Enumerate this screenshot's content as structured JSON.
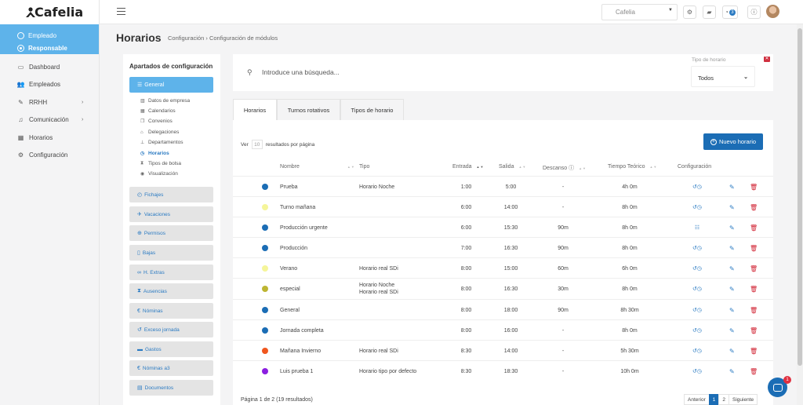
{
  "app": {
    "logo": "Cafelia"
  },
  "roles": [
    {
      "label": "Empleado"
    },
    {
      "label": "Responsable"
    }
  ],
  "sidebar": [
    {
      "label": "Dashboard",
      "icon": "monitor-icon"
    },
    {
      "label": "Empleados",
      "icon": "users-icon"
    },
    {
      "label": "RRHH",
      "icon": "edit-icon"
    },
    {
      "label": "Comunicación",
      "icon": "bell-icon"
    },
    {
      "label": "Horarios",
      "icon": "calendar-icon"
    },
    {
      "label": "Configuración",
      "icon": "gear-icon"
    }
  ],
  "topbar": {
    "company": "Cafelia",
    "notifications": "3"
  },
  "page": {
    "title": "Horarios",
    "breadcrumb": "Configuración  ›  Configuración de módulos"
  },
  "config_panel": {
    "title": "Apartados de configuración",
    "active_section": "General",
    "subitems": [
      {
        "label": "Datos de empresa"
      },
      {
        "label": "Calendarios"
      },
      {
        "label": "Convenios"
      },
      {
        "label": "Delegaciones"
      },
      {
        "label": "Departamentos"
      },
      {
        "label": "Horarios"
      },
      {
        "label": "Tipos de bolsa"
      },
      {
        "label": "Visualización"
      }
    ],
    "sections": [
      {
        "label": "Fichajes",
        "icon": "clock-icon"
      },
      {
        "label": "Vacaciones",
        "icon": "plane-icon"
      },
      {
        "label": "Permisos",
        "icon": "lifebuoy-icon"
      },
      {
        "label": "Bajas",
        "icon": "bandage-icon"
      },
      {
        "label": "H. Extras",
        "icon": "binoculars-icon"
      },
      {
        "label": "Ausencias",
        "icon": "hourglass-icon"
      },
      {
        "label": "Nóminas",
        "icon": "euro-icon"
      },
      {
        "label": "Exceso jornada",
        "icon": "history-icon"
      },
      {
        "label": "Gastos",
        "icon": "card-icon"
      },
      {
        "label": "Nóminas a3",
        "icon": "euro-icon"
      },
      {
        "label": "Documentos",
        "icon": "document-icon"
      }
    ]
  },
  "search": {
    "placeholder": "Introduce una búsqueda...",
    "type_label": "Tipo de horario",
    "type_value": "Todos"
  },
  "tabs": [
    {
      "label": "Horarios"
    },
    {
      "label": "Turnos rotativos"
    },
    {
      "label": "Tipos de horario"
    }
  ],
  "table": {
    "per_page_prefix": "Ver",
    "per_page": "10",
    "per_page_suffix": "resultados por página",
    "new_button": "Nuevo horario",
    "columns": [
      "Nombre",
      "Tipo",
      "Entrada",
      "Salida",
      "Descanso",
      "Tiempo Teórico",
      "Configuración"
    ],
    "rows": [
      {
        "color": "#1b6db5",
        "name": "Prueba",
        "type": "Horario Noche",
        "type2": "",
        "in": "1:00",
        "out": "5:00",
        "break": "-",
        "time": "4h 0m",
        "cfg": "history-icon"
      },
      {
        "color": "#f5f59a",
        "name": "Turno mañana",
        "type": "",
        "type2": "",
        "in": "6:00",
        "out": "14:00",
        "break": "-",
        "time": "8h 0m",
        "cfg": "history-icon"
      },
      {
        "color": "#1b6db5",
        "name": "Producción urgente",
        "type": "",
        "type2": "",
        "in": "6:00",
        "out": "15:30",
        "break": "90m",
        "time": "8h 0m",
        "cfg": "sliders-icon"
      },
      {
        "color": "#1b6db5",
        "name": "Producción",
        "type": "",
        "type2": "",
        "in": "7:00",
        "out": "16:30",
        "break": "90m",
        "time": "8h 0m",
        "cfg": "history-icon"
      },
      {
        "color": "#f5f59a",
        "name": "Verano",
        "type": "Horario real SDi",
        "type2": "",
        "in": "8:00",
        "out": "15:00",
        "break": "60m",
        "time": "6h 0m",
        "cfg": "history-icon"
      },
      {
        "color": "#bdb532",
        "name": "especial",
        "type": "Horario Noche",
        "type2": "Horario real SDi",
        "in": "8:00",
        "out": "16:30",
        "break": "30m",
        "time": "8h 0m",
        "cfg": "history-icon"
      },
      {
        "color": "#1b6db5",
        "name": "General",
        "type": "",
        "type2": "",
        "in": "8:00",
        "out": "18:00",
        "break": "90m",
        "time": "8h 30m",
        "cfg": "history-icon"
      },
      {
        "color": "#1b6db5",
        "name": "Jornada completa",
        "type": "",
        "type2": "",
        "in": "8:00",
        "out": "16:00",
        "break": "-",
        "time": "8h 0m",
        "cfg": "history-icon"
      },
      {
        "color": "#f0561e",
        "name": "Mañana Invierno",
        "type": "Horario real SDi",
        "type2": "",
        "in": "8:30",
        "out": "14:00",
        "break": "-",
        "time": "5h 30m",
        "cfg": "history-icon"
      },
      {
        "color": "#8b1ee0",
        "name": "Luis prueba 1",
        "type": "Horario tipo por defecto",
        "type2": "",
        "in": "8:30",
        "out": "18:30",
        "break": "-",
        "time": "10h 0m",
        "cfg": "history-icon"
      }
    ],
    "footer": "Página 1 de 2 (19 resultados)",
    "pager": {
      "prev": "Anterior",
      "pages": [
        "1",
        "2"
      ],
      "next": "Siguiente"
    }
  },
  "chat": {
    "badge": "1"
  }
}
